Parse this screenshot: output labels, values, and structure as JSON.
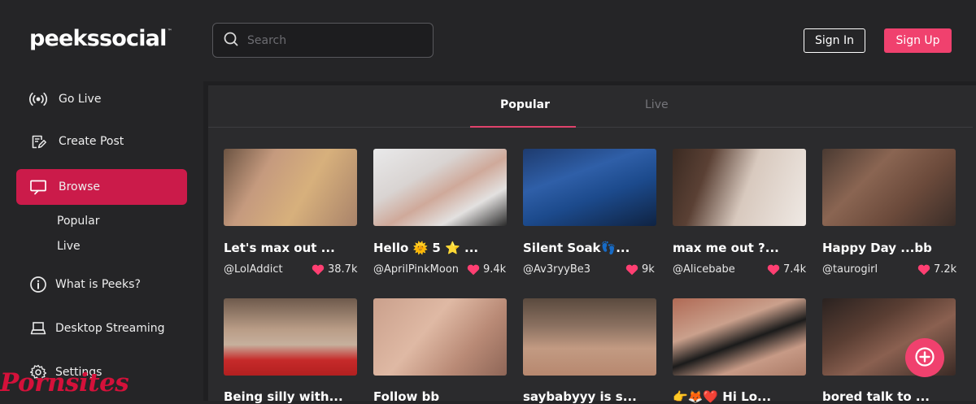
{
  "brand": {
    "name": "peekssocial",
    "trademark": "™"
  },
  "search": {
    "placeholder": "Search",
    "value": ""
  },
  "header": {
    "sign_in": "Sign In",
    "sign_up": "Sign Up"
  },
  "sidebar": {
    "items": [
      {
        "label": "Go Live",
        "icon": "broadcast-icon"
      },
      {
        "label": "Create Post",
        "icon": "edit-post-icon"
      },
      {
        "label": "Browse",
        "icon": "monitor-icon",
        "active": true
      },
      {
        "label": "What is Peeks?",
        "icon": "info-icon"
      },
      {
        "label": "Desktop Streaming",
        "icon": "laptop-icon"
      },
      {
        "label": "Settings",
        "icon": "gear-icon"
      }
    ],
    "browse_sub": [
      "Popular",
      "Live"
    ]
  },
  "watermark": "Pornsites",
  "tabs": [
    {
      "label": "Popular",
      "active": true
    },
    {
      "label": "Live",
      "active": false
    }
  ],
  "cards": [
    {
      "title": "Let's max out ...",
      "user": "@LolAddict",
      "likes": "38.7k"
    },
    {
      "title": "Hello 🌞 5 ⭐ ...",
      "user": "@AprilPinkMoon",
      "likes": "9.4k"
    },
    {
      "title": "Silent Soak👣...",
      "user": "@Av3ryyBe3",
      "likes": "9k"
    },
    {
      "title": "max me out ?...",
      "user": "@Alicebabe",
      "likes": "7.4k"
    },
    {
      "title": "Happy Day ...bb",
      "user": "@taurogirl",
      "likes": "7.2k"
    },
    {
      "title": "Being silly with..."
    },
    {
      "title": "Follow bb"
    },
    {
      "title": "saybabyyy is s..."
    },
    {
      "title": "👉🦊❤️ Hi Lo..."
    },
    {
      "title": "bored talk to ..."
    }
  ],
  "colors": {
    "accent": "#f0416e",
    "active_nav": "#cb1b4a",
    "background": "#252527",
    "like_heart": "#ff3f72"
  }
}
